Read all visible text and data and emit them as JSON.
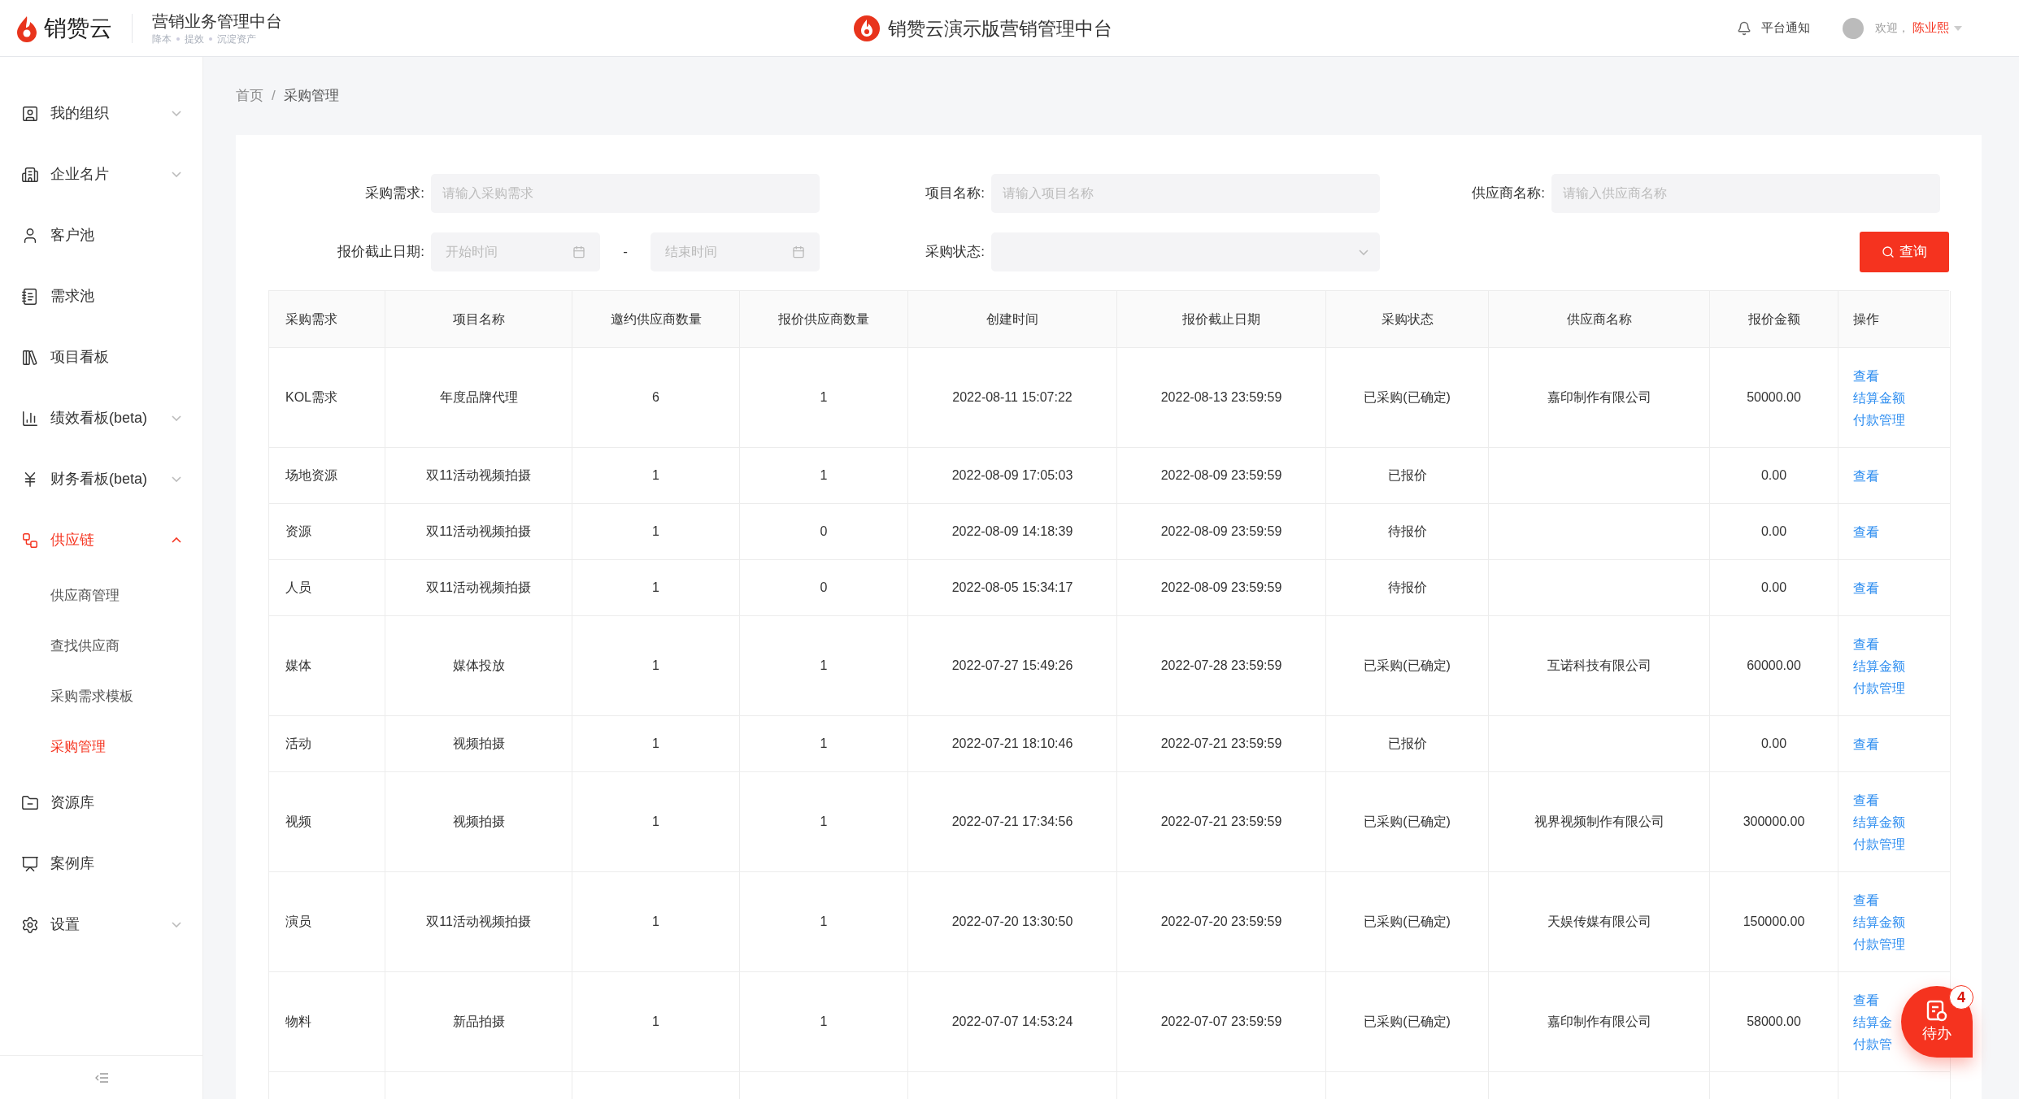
{
  "header": {
    "logo_text": "销赞云",
    "app_title": "营销业务管理中台",
    "tagline": [
      "降本",
      "提效",
      "沉淀资产"
    ],
    "center_title": "销赞云演示版营销管理中台",
    "notification": "平台通知",
    "welcome": "欢迎，",
    "user": "陈业熙"
  },
  "sidebar": {
    "items": [
      {
        "label": "我的组织",
        "expanded": false,
        "selected": false
      },
      {
        "label": "企业名片",
        "expanded": false,
        "selected": false
      },
      {
        "label": "客户池",
        "selected": false
      },
      {
        "label": "需求池",
        "selected": false
      },
      {
        "label": "项目看板",
        "selected": false
      },
      {
        "label": "绩效看板(beta)",
        "expanded": false,
        "selected": false
      },
      {
        "label": "财务看板(beta)",
        "expanded": false,
        "selected": false
      },
      {
        "label": "供应链",
        "expanded": true,
        "selected": true,
        "children": [
          {
            "label": "供应商管理",
            "selected": false
          },
          {
            "label": "查找供应商",
            "selected": false
          },
          {
            "label": "采购需求模板",
            "selected": false
          },
          {
            "label": "采购管理",
            "selected": true
          }
        ]
      },
      {
        "label": "资源库",
        "selected": false
      },
      {
        "label": "案例库",
        "selected": false
      },
      {
        "label": "设置",
        "expanded": false,
        "selected": false
      }
    ]
  },
  "breadcrumb": [
    "首页",
    "采购管理"
  ],
  "breadcrumb_separator": "/",
  "filters": {
    "rows": [
      [
        {
          "kind": "text",
          "label": "采购需求:",
          "placeholder": "请输入采购需求"
        },
        {
          "kind": "text",
          "label": "项目名称:",
          "placeholder": "请输入项目名称"
        },
        {
          "kind": "text",
          "label": "供应商名称:",
          "placeholder": "请输入供应商名称"
        }
      ],
      [
        {
          "kind": "daterange",
          "label": "报价截止日期:",
          "start_placeholder": "开始时间",
          "separator": "-",
          "end_placeholder": "结束时间"
        },
        {
          "kind": "select",
          "label": "采购状态:"
        },
        {
          "kind": "button",
          "label": "查询"
        }
      ]
    ]
  },
  "table": {
    "columns": [
      "采购需求",
      "项目名称",
      "邀约供应商数量",
      "报价供应商数量",
      "创建时间",
      "报价截止日期",
      "采购状态",
      "供应商名称",
      "报价金额",
      "操作"
    ],
    "rows": [
      {
        "demand": "KOL需求",
        "project": "年度品牌代理",
        "invited": "6",
        "quoted": "1",
        "created": "2022-08-11 15:07:22",
        "deadline": "2022-08-13 23:59:59",
        "status": "已采购(已确定)",
        "supplier": "嘉印制作有限公司",
        "amount": "50000.00",
        "actions": [
          "查看",
          "结算金额",
          "付款管理"
        ]
      },
      {
        "demand": "场地资源",
        "project": "双11活动视频拍摄",
        "invited": "1",
        "quoted": "1",
        "created": "2022-08-09 17:05:03",
        "deadline": "2022-08-09 23:59:59",
        "status": "已报价",
        "amount": "0.00",
        "actions": [
          "查看"
        ]
      },
      {
        "demand": "资源",
        "project": "双11活动视频拍摄",
        "invited": "1",
        "quoted": "0",
        "created": "2022-08-09 14:18:39",
        "deadline": "2022-08-09 23:59:59",
        "status": "待报价",
        "amount": "0.00",
        "actions": [
          "查看"
        ]
      },
      {
        "demand": "人员",
        "project": "双11活动视频拍摄",
        "invited": "1",
        "quoted": "0",
        "created": "2022-08-05 15:34:17",
        "deadline": "2022-08-09 23:59:59",
        "status": "待报价",
        "amount": "0.00",
        "actions": [
          "查看"
        ]
      },
      {
        "demand": "媒体",
        "project": "媒体投放",
        "invited": "1",
        "quoted": "1",
        "created": "2022-07-27 15:49:26",
        "deadline": "2022-07-28 23:59:59",
        "status": "已采购(已确定)",
        "supplier": "互诺科技有限公司",
        "amount": "60000.00",
        "actions": [
          "查看",
          "结算金额",
          "付款管理"
        ]
      },
      {
        "demand": "活动",
        "project": "视频拍摄",
        "invited": "1",
        "quoted": "1",
        "created": "2022-07-21 18:10:46",
        "deadline": "2022-07-21 23:59:59",
        "status": "已报价",
        "amount": "0.00",
        "actions": [
          "查看"
        ]
      },
      {
        "demand": "视频",
        "project": "视频拍摄",
        "invited": "1",
        "quoted": "1",
        "created": "2022-07-21 17:34:56",
        "deadline": "2022-07-21 23:59:59",
        "status": "已采购(已确定)",
        "supplier": "视界视频制作有限公司",
        "amount": "300000.00",
        "actions": [
          "查看",
          "结算金额",
          "付款管理"
        ]
      },
      {
        "demand": "演员",
        "project": "双11活动视频拍摄",
        "invited": "1",
        "quoted": "1",
        "created": "2022-07-20 13:30:50",
        "deadline": "2022-07-20 23:59:59",
        "status": "已采购(已确定)",
        "supplier": "天娱传媒有限公司",
        "amount": "150000.00",
        "actions": [
          "查看",
          "结算金额",
          "付款管理"
        ]
      },
      {
        "demand": "物料",
        "project": "新品拍摄",
        "invited": "1",
        "quoted": "1",
        "created": "2022-07-07 14:53:24",
        "deadline": "2022-07-07 23:59:59",
        "status": "已采购(已确定)",
        "supplier": "嘉印制作有限公司",
        "amount": "58000.00",
        "actions": [
          "查看",
          "结算金",
          "付款管"
        ]
      }
    ]
  },
  "todo_button": {
    "label": "待办",
    "badge": "4"
  }
}
